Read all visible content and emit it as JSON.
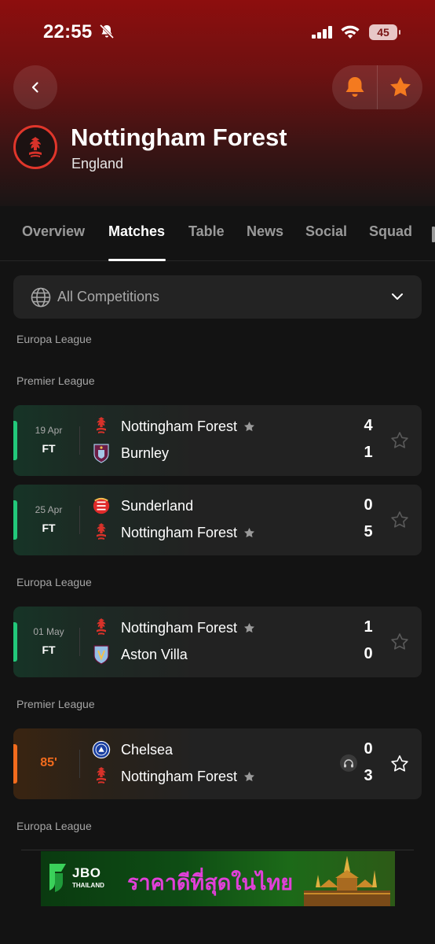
{
  "status_bar": {
    "time": "22:55",
    "battery": "45"
  },
  "header": {
    "team_name": "Nottingham Forest",
    "country": "England"
  },
  "tabs": [
    {
      "label": "Overview"
    },
    {
      "label": "Matches"
    },
    {
      "label": "Table"
    },
    {
      "label": "News"
    },
    {
      "label": "Social"
    },
    {
      "label": "Squad"
    }
  ],
  "filter": {
    "label": "All Competitions"
  },
  "sections": [
    {
      "label": "Europa League"
    },
    {
      "label": "Premier League"
    },
    {
      "label": "Europa League"
    },
    {
      "label": "Premier League"
    },
    {
      "label": "Europa League"
    }
  ],
  "matches": [
    {
      "date": "19 Apr",
      "status": "FT",
      "home": "Nottingham Forest",
      "away": "Burnley",
      "home_score": "4",
      "away_score": "1"
    },
    {
      "date": "25 Apr",
      "status": "FT",
      "home": "Sunderland",
      "away": "Nottingham Forest",
      "home_score": "0",
      "away_score": "5"
    },
    {
      "date": "01 May",
      "status": "FT",
      "home": "Nottingham Forest",
      "away": "Aston Villa",
      "home_score": "1",
      "away_score": "0"
    },
    {
      "date": "",
      "status": "85'",
      "home": "Chelsea",
      "away": "Nottingham Forest",
      "home_score": "0",
      "away_score": "3"
    }
  ],
  "ad": {
    "brand": "JBO",
    "brand_sub": "THAILAND",
    "text": "ราคาดีที่สุดในไทย"
  },
  "colors": {
    "accent_red": "#e0362b",
    "finished_green": "#22c87a",
    "live_orange": "#f26b1d",
    "favorite_orange": "#f47a1f"
  }
}
